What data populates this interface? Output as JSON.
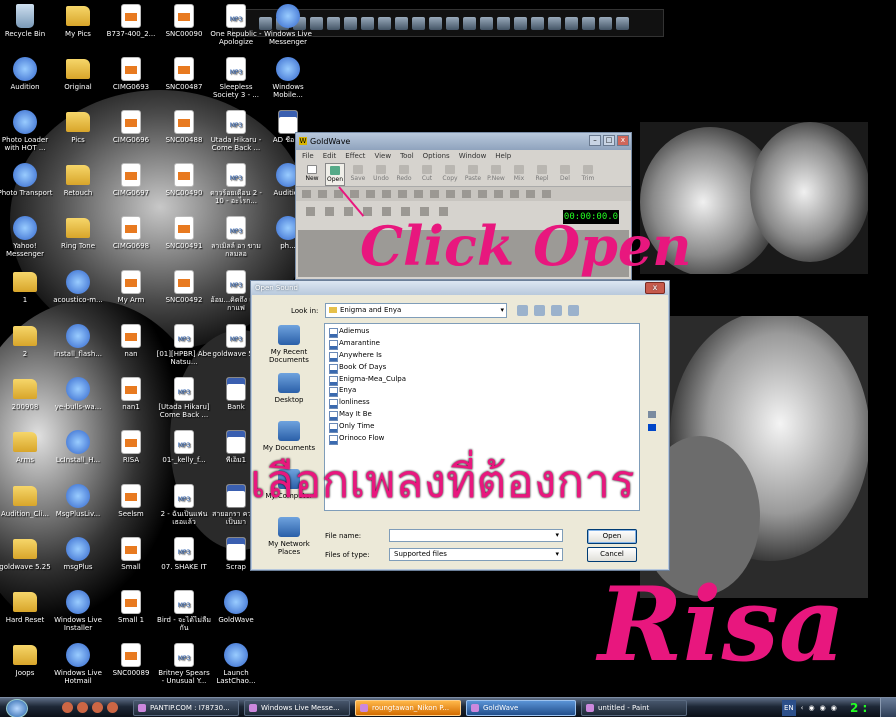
{
  "desktop_icons": [
    {
      "label": "Recycle Bin",
      "kind": "recycle",
      "col": 0,
      "row": 0
    },
    {
      "label": "Audition",
      "kind": "app",
      "col": 0,
      "row": 1
    },
    {
      "label": "Photo Loader with HOT ...",
      "kind": "app",
      "col": 0,
      "row": 2
    },
    {
      "label": "Photo Transport",
      "kind": "app",
      "col": 0,
      "row": 3
    },
    {
      "label": "Yahoo! Messenger",
      "kind": "app",
      "col": 0,
      "row": 4
    },
    {
      "label": "1",
      "kind": "folder",
      "col": 0,
      "row": 5
    },
    {
      "label": "2",
      "kind": "folder",
      "col": 0,
      "row": 6
    },
    {
      "label": "200908",
      "kind": "folder",
      "col": 0,
      "row": 7
    },
    {
      "label": "Arms",
      "kind": "folder",
      "col": 0,
      "row": 8
    },
    {
      "label": "Audition_Cli...",
      "kind": "folder",
      "col": 0,
      "row": 9
    },
    {
      "label": "goldwave 5.25",
      "kind": "folder",
      "col": 0,
      "row": 10
    },
    {
      "label": "Hard Reset",
      "kind": "folder",
      "col": 0,
      "row": 11
    },
    {
      "label": "Joops",
      "kind": "folder",
      "col": 0,
      "row": 12
    },
    {
      "label": "My Pics",
      "kind": "folder",
      "col": 1,
      "row": 0
    },
    {
      "label": "Original",
      "kind": "folder",
      "col": 1,
      "row": 1
    },
    {
      "label": "Pics",
      "kind": "folder",
      "col": 1,
      "row": 2
    },
    {
      "label": "Retouch",
      "kind": "folder",
      "col": 1,
      "row": 3
    },
    {
      "label": "Ring Tone",
      "kind": "folder",
      "col": 1,
      "row": 4
    },
    {
      "label": "acoustico-m...",
      "kind": "app",
      "col": 1,
      "row": 5
    },
    {
      "label": "install_flash...",
      "kind": "app",
      "col": 1,
      "row": 6
    },
    {
      "label": "ye-bulls-wa...",
      "kind": "app",
      "col": 1,
      "row": 7
    },
    {
      "label": "LcInstall_H...",
      "kind": "app",
      "col": 1,
      "row": 8
    },
    {
      "label": "MsgPlusLiv...",
      "kind": "app",
      "col": 1,
      "row": 9
    },
    {
      "label": "msgPlus",
      "kind": "app",
      "col": 1,
      "row": 10
    },
    {
      "label": "Windows Live Installer",
      "kind": "app",
      "col": 1,
      "row": 11
    },
    {
      "label": "Windows Live Hotmail",
      "kind": "app",
      "col": 1,
      "row": 12
    },
    {
      "label": "B737-400_2...",
      "kind": "jpg",
      "col": 2,
      "row": 0
    },
    {
      "label": "CIMG0693",
      "kind": "jpg",
      "col": 2,
      "row": 1
    },
    {
      "label": "CIMG0696",
      "kind": "jpg",
      "col": 2,
      "row": 2
    },
    {
      "label": "CIMG0697",
      "kind": "jpg",
      "col": 2,
      "row": 3
    },
    {
      "label": "CIMG0698",
      "kind": "jpg",
      "col": 2,
      "row": 4
    },
    {
      "label": "My Arm",
      "kind": "jpg",
      "col": 2,
      "row": 5
    },
    {
      "label": "nan",
      "kind": "jpg",
      "col": 2,
      "row": 6
    },
    {
      "label": "nan1",
      "kind": "jpg",
      "col": 2,
      "row": 7
    },
    {
      "label": "RISA",
      "kind": "jpg",
      "col": 2,
      "row": 8
    },
    {
      "label": "Seelsm",
      "kind": "jpg",
      "col": 2,
      "row": 9
    },
    {
      "label": "Small",
      "kind": "jpg",
      "col": 2,
      "row": 10
    },
    {
      "label": "Small 1",
      "kind": "jpg",
      "col": 2,
      "row": 11
    },
    {
      "label": "SNC00089",
      "kind": "jpg",
      "col": 2,
      "row": 12
    },
    {
      "label": "SNC00090",
      "kind": "jpg",
      "col": 3,
      "row": 0
    },
    {
      "label": "SNC00487",
      "kind": "jpg",
      "col": 3,
      "row": 1
    },
    {
      "label": "SNC00488",
      "kind": "jpg",
      "col": 3,
      "row": 2
    },
    {
      "label": "SNC00490",
      "kind": "jpg",
      "col": 3,
      "row": 3
    },
    {
      "label": "SNC00491",
      "kind": "jpg",
      "col": 3,
      "row": 4
    },
    {
      "label": "SNC00492",
      "kind": "jpg",
      "col": 3,
      "row": 5
    },
    {
      "label": "[01][HPBR] Abe Natsu...",
      "kind": "mp3",
      "col": 3,
      "row": 6
    },
    {
      "label": "[Utada Hikaru] Come Back ...",
      "kind": "mp3",
      "col": 3,
      "row": 7
    },
    {
      "label": "01-_kelly_f...",
      "kind": "mp3",
      "col": 3,
      "row": 8
    },
    {
      "label": "2 - ฉันเป็นแฟนเธอแล้ว",
      "kind": "mp3",
      "col": 3,
      "row": 9
    },
    {
      "label": "07. SHAKE IT",
      "kind": "mp3",
      "col": 3,
      "row": 10
    },
    {
      "label": "Bird - จะได้ไม่ลืมกัน",
      "kind": "mp3",
      "col": 3,
      "row": 11
    },
    {
      "label": "Britney Spears - Unusual Y...",
      "kind": "mp3",
      "col": 3,
      "row": 12
    },
    {
      "label": "One Republic - Apologize",
      "kind": "mp3",
      "col": 4,
      "row": 0
    },
    {
      "label": "Sleepless Society 3 - ...",
      "kind": "mp3",
      "col": 4,
      "row": 1
    },
    {
      "label": "Utada Hikaru - Come Back ...",
      "kind": "mp3",
      "col": 4,
      "row": 2
    },
    {
      "label": "ดาวร้อยเดือน 2 - 10 - อะไรก...",
      "kind": "mp3",
      "col": 4,
      "row": 3
    },
    {
      "label": "ลาเมิลล์ อา ขามกลมลอ",
      "kind": "mp3",
      "col": 4,
      "row": 4
    },
    {
      "label": "อ้อม...คิดถึง แสงกาแฟ",
      "kind": "mp3",
      "col": 4,
      "row": 5
    },
    {
      "label": "goldwave 5...",
      "kind": "mp3",
      "col": 4,
      "row": 6
    },
    {
      "label": "Bank",
      "kind": "word",
      "col": 4,
      "row": 7
    },
    {
      "label": "พี่เอ็ม1",
      "kind": "word",
      "col": 4,
      "row": 8
    },
    {
      "label": "สายอกรา ความเป็นมา",
      "kind": "word",
      "col": 4,
      "row": 9
    },
    {
      "label": "Scrap",
      "kind": "word",
      "col": 4,
      "row": 10
    },
    {
      "label": "GoldWave",
      "kind": "app",
      "col": 4,
      "row": 11
    },
    {
      "label": "Launch LastChao...",
      "kind": "app",
      "col": 4,
      "row": 12
    },
    {
      "label": "Windows Live Messenger",
      "kind": "app",
      "col": 5,
      "row": 0
    },
    {
      "label": "Windows Mobile...",
      "kind": "app",
      "col": 5,
      "row": 1
    },
    {
      "label": "AD ชื่อ ...",
      "kind": "word",
      "col": 5,
      "row": 2
    },
    {
      "label": "Audition",
      "kind": "app",
      "col": 5,
      "row": 3
    },
    {
      "label": "ph...",
      "kind": "app",
      "col": 5,
      "row": 4
    }
  ],
  "goldwave": {
    "title": "GoldWave",
    "menu": [
      "File",
      "Edit",
      "Effect",
      "View",
      "Tool",
      "Options",
      "Window",
      "Help"
    ],
    "tools": [
      "New",
      "Open",
      "Save",
      "Undo",
      "Redo",
      "Cut",
      "Copy",
      "Paste",
      "P.New",
      "Mix",
      "Repl",
      "Del",
      "Trim"
    ],
    "timer": "00:00:00.0"
  },
  "dialog": {
    "title": "Open Sound",
    "look_in_label": "Look in:",
    "look_in_value": "Enigma and Enya",
    "places": [
      "My Recent Documents",
      "Desktop",
      "My Documents",
      "My Computer",
      "My Network Places"
    ],
    "files": [
      "Adiemus",
      "Amarantine",
      "Anywhere Is",
      "Book Of Days",
      "Enigma-Mea_Culpa",
      "Enya",
      "lonliness",
      "May It Be",
      "Only Time",
      "Orinoco Flow"
    ],
    "file_name_label": "File name:",
    "file_name_value": "",
    "files_of_type_label": "Files of type:",
    "files_of_type_value": "Supported files",
    "open_button": "Open",
    "cancel_button": "Cancel"
  },
  "overlay": {
    "click_open": "Click Open",
    "thai_text": "เลือกเพลงที่ต้องการ",
    "risa": "Risa"
  },
  "taskbar": {
    "tasks": [
      {
        "label": "PANTIP.COM : I78730...",
        "state": "normal"
      },
      {
        "label": "Windows Live Messe...",
        "state": "normal"
      },
      {
        "label": "roungtawan_Nikon P...",
        "state": "highlight"
      },
      {
        "label": "GoldWave",
        "state": "active"
      },
      {
        "label": "untitled - Paint",
        "state": "normal"
      }
    ],
    "language": "EN",
    "clock": "2 :"
  },
  "colors": {
    "accent_pink": "#e8177e",
    "clock_green": "#22ff22"
  }
}
